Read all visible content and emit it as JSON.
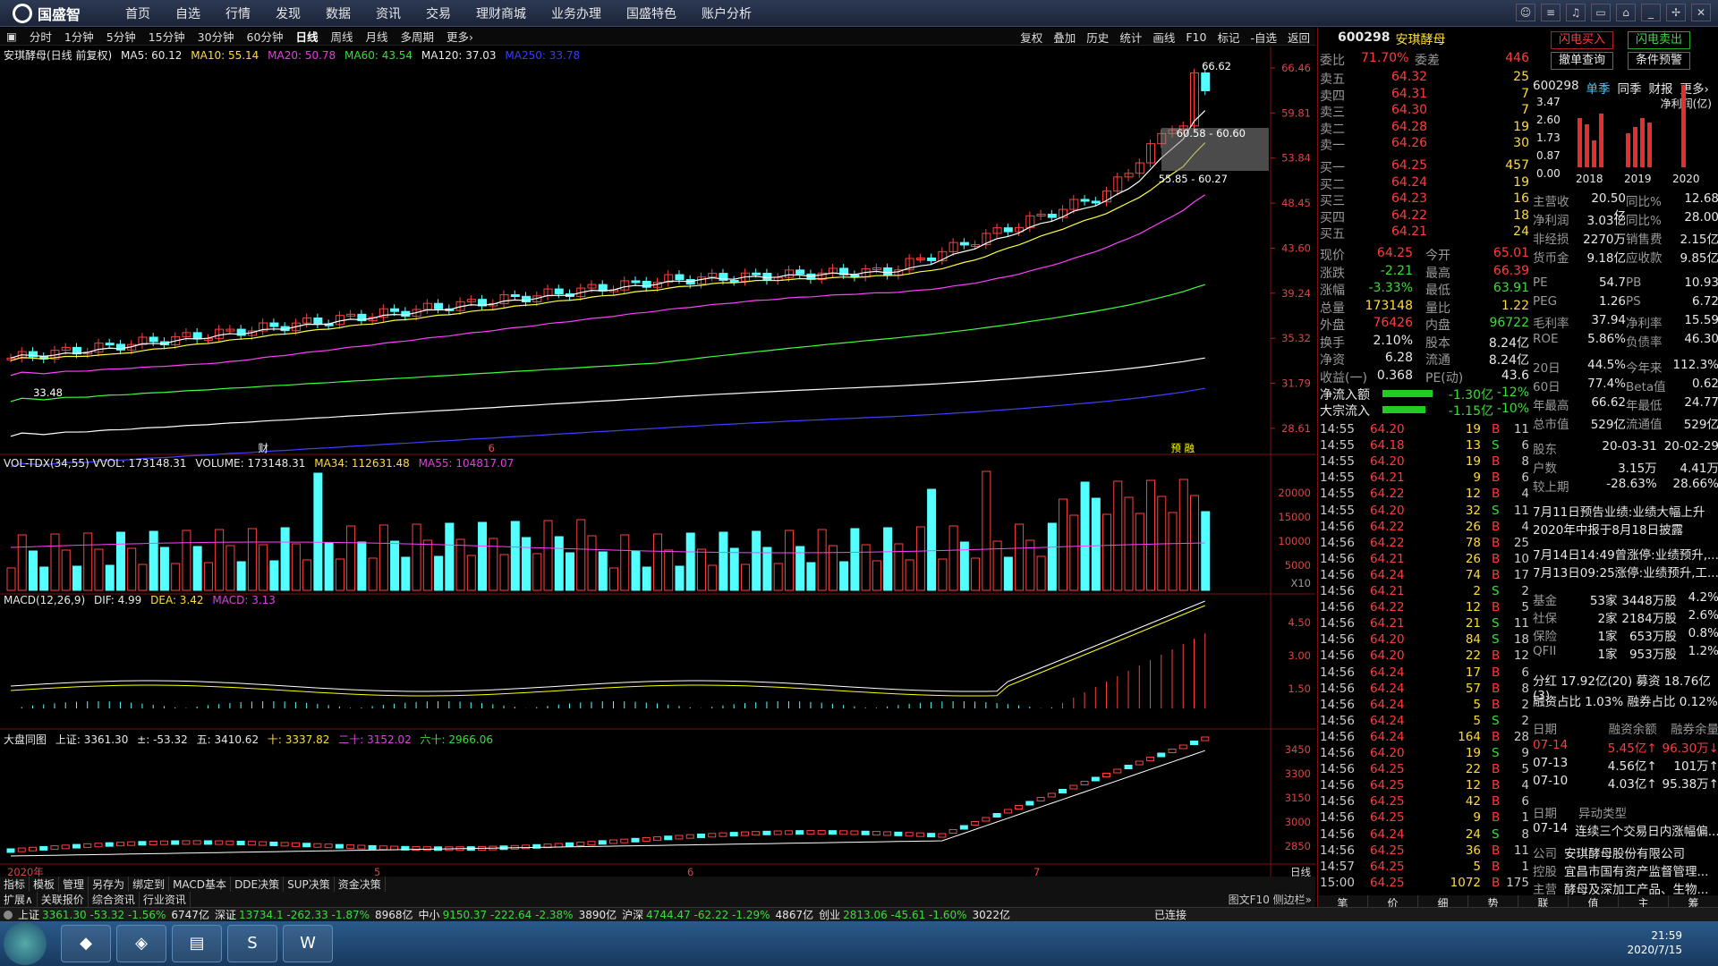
{
  "app": {
    "brand": "国盛智",
    "menu": [
      "首页",
      "自选",
      "行情",
      "发现",
      "数据",
      "资讯",
      "交易",
      "理财商城",
      "业务办理",
      "国盛特色",
      "账户分析"
    ]
  },
  "periods": [
    "分时",
    "1分钟",
    "5分钟",
    "15分钟",
    "30分钟",
    "60分钟",
    "日线",
    "周线",
    "月线",
    "多周期",
    "更多›"
  ],
  "active_period": "日线",
  "toolbar": [
    "复权",
    "叠加",
    "历史",
    "统计",
    "画线",
    "F10",
    "标记",
    "-自选",
    "返回"
  ],
  "kline": {
    "name": "安琪酵母(日线 前复权)",
    "ma5": "MA5: 60.12",
    "ma10": "MA10: 55.14",
    "ma20": "MA20: 50.78",
    "ma60": "MA60: 43.54",
    "ma120": "MA120: 37.03",
    "ma250": "MA250: 33.78",
    "axis": [
      "66.46",
      "59.81",
      "53.84",
      "48.45",
      "43.60",
      "39.24",
      "35.32",
      "31.79",
      "28.61"
    ],
    "high_label": "66.62",
    "low_label": "33.48",
    "box1": "60.58 - 60.60",
    "box2": "55.85 - 60.27",
    "mark1": "财",
    "mark2": "6",
    "mark3": "预 融"
  },
  "volume": {
    "legend": "VOL-TDX(34,55)  VVOL: 173148.31",
    "volume": "VOLUME: 173148.31",
    "ma34": "MA34: 112631.48",
    "ma55": "MA55: 104817.07",
    "axis": [
      "20000",
      "15000",
      "10000",
      "5000"
    ],
    "unit": "X10"
  },
  "macd": {
    "legend": "MACD(12,26,9)",
    "dif": "DIF: 4.99",
    "dea": "DEA: 3.42",
    "macd": "MACD: 3.13",
    "axis": [
      "4.50",
      "3.00",
      "1.50"
    ]
  },
  "index": {
    "legend": "大盘同图",
    "sh": "上证: 3361.30",
    "chg": "±: -53.32",
    "wu": "五: 3410.62",
    "shi": "十: 3337.82",
    "ershi": "二十: 3152.02",
    "liushi": "六十: 2966.06",
    "axis": [
      "3450",
      "3300",
      "3150",
      "3000",
      "2850"
    ]
  },
  "xaxis": [
    "2020年",
    "5",
    "6",
    "7"
  ],
  "xaxis_right": "日线",
  "bottom_tabs1": [
    "指标",
    "模板",
    "管理",
    "另存为",
    "绑定到",
    "MACD基本",
    "DDE决策",
    "SUP决策",
    "资金决策"
  ],
  "bottom_tabs2": [
    "扩展∧",
    "关联报价",
    "综合资讯",
    "行业资讯"
  ],
  "bottom_right": "图文F10 侧边栏»",
  "right": {
    "code": "600298",
    "name": "安琪酵母",
    "btn_buy": "闪电买入",
    "btn_sell": "闪电卖出",
    "btn_q": "撤单查询",
    "btn_alert": "条件预警",
    "weibi_label": "委比",
    "weibi": "71.70%",
    "weicha_label": "委差",
    "weicha": "446",
    "sells": [
      [
        "卖五",
        "64.32",
        "25"
      ],
      [
        "卖四",
        "64.31",
        "7"
      ],
      [
        "卖三",
        "64.30",
        "7"
      ],
      [
        "卖二",
        "64.28",
        "19"
      ],
      [
        "卖一",
        "64.26",
        "30"
      ]
    ],
    "buys": [
      [
        "买一",
        "64.25",
        "457"
      ],
      [
        "买二",
        "64.24",
        "19"
      ],
      [
        "买三",
        "64.23",
        "16"
      ],
      [
        "买四",
        "64.22",
        "18"
      ],
      [
        "买五",
        "64.21",
        "24"
      ]
    ],
    "quote": [
      [
        "现价",
        "64.25",
        "今开",
        "65.01"
      ],
      [
        "涨跌",
        "-2.21",
        "最高",
        "66.39"
      ],
      [
        "涨幅",
        "-3.33%",
        "最低",
        "63.91"
      ],
      [
        "总量",
        "173148",
        "量比",
        "1.22"
      ],
      [
        "外盘",
        "76426",
        "内盘",
        "96722"
      ],
      [
        "换手",
        "2.10%",
        "股本",
        "8.24亿"
      ],
      [
        "净资",
        "6.28",
        "流通",
        "8.24亿"
      ],
      [
        "收益(一)",
        "0.368",
        "PE(动)",
        "43.6"
      ]
    ],
    "flow": [
      [
        "净流入额",
        "-1.30亿",
        "-12%"
      ],
      [
        "大宗流入",
        "-1.15亿",
        "-10%"
      ]
    ],
    "ticks": [
      [
        "14:55",
        "64.20",
        "19",
        "B",
        "11"
      ],
      [
        "14:55",
        "64.18",
        "13",
        "S",
        "6"
      ],
      [
        "14:55",
        "64.20",
        "19",
        "B",
        "8"
      ],
      [
        "14:55",
        "64.21",
        "9",
        "B",
        "6"
      ],
      [
        "14:55",
        "64.22",
        "12",
        "B",
        "4"
      ],
      [
        "14:55",
        "64.20",
        "32",
        "S",
        "11"
      ],
      [
        "14:56",
        "64.22",
        "26",
        "B",
        "4"
      ],
      [
        "14:56",
        "64.22",
        "78",
        "B",
        "25"
      ],
      [
        "14:56",
        "64.21",
        "26",
        "B",
        "10"
      ],
      [
        "14:56",
        "64.24",
        "74",
        "B",
        "17"
      ],
      [
        "14:56",
        "64.21",
        "2",
        "S",
        "2"
      ],
      [
        "14:56",
        "64.22",
        "12",
        "B",
        "5"
      ],
      [
        "14:56",
        "64.21",
        "21",
        "S",
        "11"
      ],
      [
        "14:56",
        "64.20",
        "84",
        "S",
        "18"
      ],
      [
        "14:56",
        "64.20",
        "22",
        "B",
        "12"
      ],
      [
        "14:56",
        "64.24",
        "17",
        "B",
        "6"
      ],
      [
        "14:56",
        "64.24",
        "57",
        "B",
        "8"
      ],
      [
        "14:56",
        "64.24",
        "5",
        "B",
        "2"
      ],
      [
        "14:56",
        "64.24",
        "5",
        "S",
        "2"
      ],
      [
        "14:56",
        "64.24",
        "164",
        "B",
        "28"
      ],
      [
        "14:56",
        "64.20",
        "19",
        "S",
        "9"
      ],
      [
        "14:56",
        "64.25",
        "22",
        "B",
        "5"
      ],
      [
        "14:56",
        "64.25",
        "12",
        "B",
        "4"
      ],
      [
        "14:56",
        "64.25",
        "42",
        "B",
        "6"
      ],
      [
        "14:56",
        "64.25",
        "9",
        "B",
        "1"
      ],
      [
        "14:56",
        "64.24",
        "24",
        "S",
        "8"
      ],
      [
        "14:56",
        "64.25",
        "36",
        "B",
        "11"
      ],
      [
        "14:57",
        "64.25",
        "5",
        "B",
        "1"
      ],
      [
        "15:00",
        "64.25",
        "1072",
        "B",
        "175"
      ]
    ],
    "info_tabs": [
      "600298",
      "单季",
      "同季",
      "财报",
      "更多›"
    ],
    "fin_axis": [
      "3.47",
      "2.60",
      "1.73",
      "0.87",
      "0.00"
    ],
    "fin_title": "净利润(亿)",
    "fin_years": [
      "2018",
      "2019",
      "2020"
    ],
    "fin": [
      [
        "主营收",
        "20.50亿",
        "同比%",
        "12.68"
      ],
      [
        "净利润",
        "3.03亿",
        "同比%",
        "28.00"
      ],
      [
        "非经损",
        "2270万",
        "销售费",
        "2.15亿"
      ],
      [
        "货币金",
        "9.18亿",
        "应收款",
        "9.85亿"
      ]
    ],
    "ratios": [
      [
        "PE",
        "54.7",
        "PB",
        "10.93"
      ],
      [
        "PEG",
        "1.26",
        "PS",
        "6.72"
      ],
      [
        "毛利率",
        "37.94",
        "净利率",
        "15.59"
      ],
      [
        "ROE",
        "5.86%",
        "负债率",
        "46.30"
      ]
    ],
    "stats": [
      [
        "20日",
        "44.5%",
        "今年来",
        "112.3%"
      ],
      [
        "60日",
        "77.4%",
        "Beta值",
        "0.62"
      ],
      [
        "年最高",
        "66.62",
        "年最低",
        "24.77"
      ],
      [
        "总市值",
        "529亿",
        "流通值",
        "529亿"
      ]
    ],
    "holders": [
      [
        "股东",
        "20-03-31",
        "20-02-29"
      ],
      [
        "户数",
        "3.15万",
        "4.41万"
      ],
      [
        "较上期",
        "-28.63%",
        "28.66%"
      ]
    ],
    "news": [
      "7月11日预告业绩:业绩大幅上升",
      "2020年中报于8月18日披露",
      "7月14日14:49曾涨停:业绩预升,...",
      "7月13日09:25涨停:业绩预升,工..."
    ],
    "inst": [
      [
        "基金",
        "53家",
        "3448万股",
        "4.2%"
      ],
      [
        "社保",
        "2家",
        "2184万股",
        "2.6%"
      ],
      [
        "保险",
        "1家",
        "653万股",
        "0.8%"
      ],
      [
        "QFII",
        "1家",
        "953万股",
        "1.2%"
      ]
    ],
    "fenhong": "分红 17.92亿(20) 募资 18.76亿(3)",
    "rzzb": "融资占比 1.03% 融券占比 0.12%",
    "margin_head": [
      "日期",
      "融资余额",
      "融券余量"
    ],
    "margin": [
      [
        "07-14",
        "5.45亿↑",
        "96.30万↓"
      ],
      [
        "07-13",
        "4.56亿↑",
        "101万↑"
      ],
      [
        "07-10",
        "4.03亿↑",
        "95.38万↑"
      ]
    ],
    "abn_head": [
      "日期",
      "异动类型"
    ],
    "abn": [
      "07-14",
      "连续三个交易日内涨幅偏..."
    ],
    "company": [
      [
        "公司",
        "安琪酵母股份有限公司"
      ],
      [
        "控股",
        "宜昌市国有资产监督管理..."
      ],
      [
        "主营",
        "酵母及深加工产品、生物..."
      ],
      [
        "地位",
        "酵母行业唯一一家高科技上..."
      ]
    ],
    "bottom_tabs": [
      "笔",
      "价",
      "细",
      "势",
      "联",
      "值",
      "主",
      "筹"
    ]
  },
  "status": {
    "items": [
      [
        "上证",
        "3361.30",
        "-53.32",
        "-1.56%",
        "6747亿"
      ],
      [
        "深证",
        "13734.1",
        "-262.33",
        "-1.87%",
        "8968亿"
      ],
      [
        "中小",
        "9150.37",
        "-222.64",
        "-2.38%",
        "3890亿"
      ],
      [
        "沪深",
        "4744.47",
        "-62.22",
        "-1.29%",
        "4867亿"
      ],
      [
        "创业",
        "2813.06",
        "-45.61",
        "-1.60%",
        "3022亿"
      ]
    ],
    "conn": "已连接"
  },
  "clock": {
    "time": "21:59",
    "date": "2020/7/15"
  }
}
